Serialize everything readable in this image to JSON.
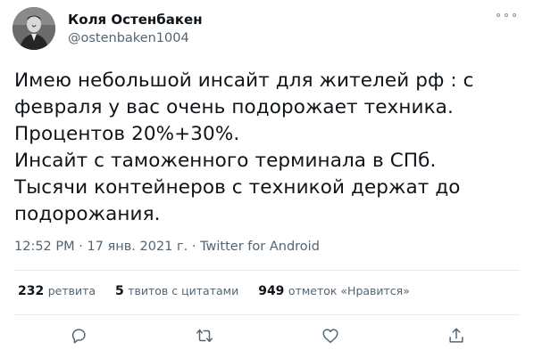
{
  "author": {
    "name": "Коля Остенбакен",
    "handle": "@ostenbaken1004",
    "avatar_icon": "avatar-photo"
  },
  "tweet": {
    "text": "Имею небольшой инсайт для жителей рф : с\nфевраля у вас очень подорожает техника.\nПроцентов 20%+30%.\nИнсайт с таможенного терминала в СПб.\nТысячи контейнеров с техникой держат до\nподорожания."
  },
  "meta": {
    "time": "12:52 PM",
    "sep1": " · ",
    "date": "17 янв. 2021 г.",
    "sep2": " · ",
    "source": "Twitter for Android"
  },
  "stats": {
    "retweets_count": "232",
    "retweets_label": "ретвита",
    "quotes_count": "5",
    "quotes_label": "твитов с цитатами",
    "likes_count": "949",
    "likes_label": "отметок «Нравится»"
  },
  "actions": [
    "reply-icon",
    "retweet-icon",
    "like-icon",
    "share-icon"
  ],
  "colors": {
    "text_primary": "#0f1419",
    "text_secondary": "#536471",
    "divider": "#e6ecf0",
    "icon": "#536471"
  }
}
